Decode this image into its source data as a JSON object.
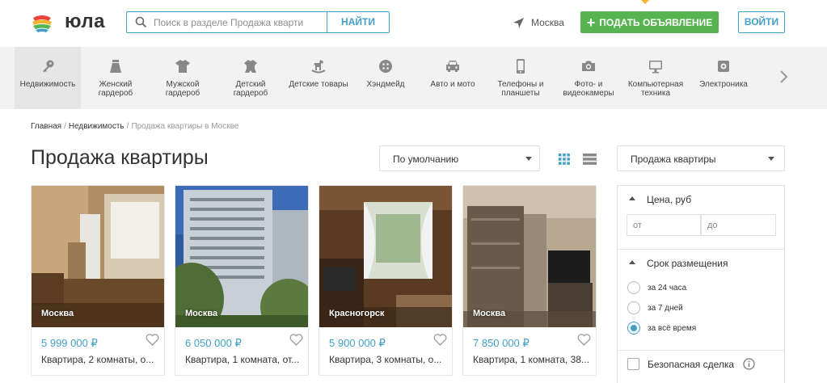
{
  "header": {
    "logo_text": "юла",
    "search_placeholder": "Поиск в разделе Продажа кварти",
    "search_button": "НАЙТИ",
    "location": "Москва",
    "post_ad_label": "ПОДАТЬ ОБЪЯВЛЕНИЕ",
    "login_label": "ВОЙТИ",
    "colors": {
      "accent": "#41a0c8",
      "post_green": "#56b550"
    }
  },
  "categories": [
    {
      "label": "Недвижимость",
      "icon": "key-icon"
    },
    {
      "label": "Женский гардероб",
      "icon": "skirt-icon"
    },
    {
      "label": "Мужской гардероб",
      "icon": "tshirt-icon"
    },
    {
      "label": "Детский гардероб",
      "icon": "baby-clothes-icon"
    },
    {
      "label": "Детские товары",
      "icon": "rocking-horse-icon"
    },
    {
      "label": "Хэндмейд",
      "icon": "button-icon"
    },
    {
      "label": "Авто и мото",
      "icon": "car-icon"
    },
    {
      "label": "Телефоны и планшеты",
      "icon": "phone-icon"
    },
    {
      "label": "Фото- и видеокамеры",
      "icon": "camera-icon"
    },
    {
      "label": "Компьютерная техника",
      "icon": "monitor-icon"
    },
    {
      "label": "Электроника",
      "icon": "electronics-icon"
    }
  ],
  "breadcrumbs": [
    "Главная",
    "Недвижимость",
    "Продажа квартиры в Москве"
  ],
  "page_title": "Продажа квартиры",
  "sort": {
    "selected": "По умолчанию"
  },
  "listings": [
    {
      "city": "Москва",
      "price": "5 999 000 ₽",
      "title": "Квартира, 2 комнаты, о..."
    },
    {
      "city": "Москва",
      "price": "6 050 000 ₽",
      "title": "Квартира, 1 комната, от..."
    },
    {
      "city": "Красногорск",
      "price": "5 900 000 ₽",
      "title": "Квартира, 3 комнаты, о..."
    },
    {
      "city": "Москва",
      "price": "7 850 000 ₽",
      "title": "Квартира, 1 комната, 38..."
    }
  ],
  "sidebar": {
    "category_select": "Продажа квартиры",
    "price_title": "Цена, руб",
    "price_from_placeholder": "от",
    "price_to_placeholder": "до",
    "period_title": "Срок размещения",
    "period_options": [
      "за 24 часа",
      "за 7 дней",
      "за всё время"
    ],
    "period_selected": "за всё время",
    "safe_deal_label": "Безопасная сделка"
  }
}
